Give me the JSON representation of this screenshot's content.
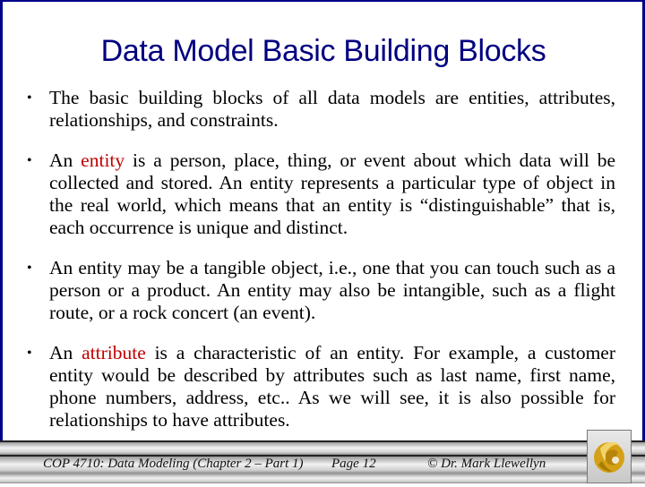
{
  "slide": {
    "title": "Data Model Basic Building Blocks",
    "bullets": [
      {
        "before": "The basic building blocks of all data models are entities, attributes, relationships, and constraints.",
        "highlight": "",
        "after": ""
      },
      {
        "before": "An ",
        "highlight": "entity",
        "after": " is a person, place, thing, or event about which data will be collected and stored.  An entity represents a particular type of object in the real world, which means that an entity is “distinguishable” that is, each occurrence is unique and distinct."
      },
      {
        "before": "An entity may be a tangible object, i.e., one that you can touch such as a person or a product.  An entity may also be intangible, such as a flight route, or a rock concert (an event).",
        "highlight": "",
        "after": ""
      },
      {
        "before": "An ",
        "highlight": "attribute",
        "after": " is a characteristic of an entity.  For example, a customer entity would be described by attributes such as last name, first name, phone numbers, address, etc..  As we will see, it is also possible for relationships to have attributes."
      }
    ],
    "bullet_glyph": "•"
  },
  "footer": {
    "course": "COP 4710: Data Modeling (Chapter 2 – Part 1)",
    "page": "Page 12",
    "author": "© Dr. Mark Llewellyn",
    "logo": "ucf-pegasus-logo-icon"
  },
  "colors": {
    "title": "#000080",
    "highlight": "#c00000",
    "border": "#000088",
    "logo_gold": "#d4a017"
  }
}
